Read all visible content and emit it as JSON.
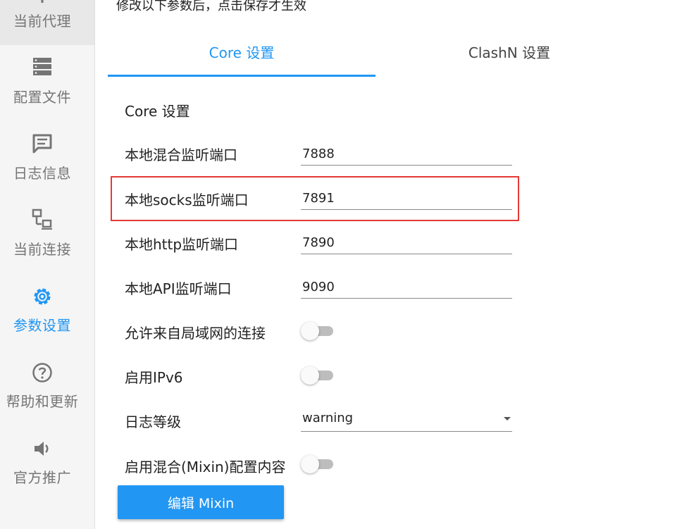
{
  "sidebar": {
    "items": [
      {
        "label": "当前代理",
        "icon": "proxy-icon"
      },
      {
        "label": "配置文件",
        "icon": "server-icon"
      },
      {
        "label": "日志信息",
        "icon": "message-icon"
      },
      {
        "label": "当前连接",
        "icon": "network-icon"
      },
      {
        "label": "参数设置",
        "icon": "gear-icon",
        "active": true
      },
      {
        "label": "帮助和更新",
        "icon": "help-icon"
      },
      {
        "label": "官方推广",
        "icon": "speaker-icon"
      }
    ]
  },
  "notice": "修改以下参数后，点击保存才生效",
  "tabs": [
    {
      "label": "Core 设置",
      "active": true
    },
    {
      "label": "ClashN 设置",
      "active": false
    }
  ],
  "section_title": "Core 设置",
  "fields": {
    "mixed_port": {
      "label": "本地混合监听端口",
      "value": "7888"
    },
    "socks_port": {
      "label": "本地socks监听端口",
      "value": "7891"
    },
    "http_port": {
      "label": "本地http监听端口",
      "value": "7890"
    },
    "api_port": {
      "label": "本地API监听端口",
      "value": "9090"
    }
  },
  "toggles": {
    "allow_lan": {
      "label": "允许来自局域网的连接",
      "on": false
    },
    "ipv6": {
      "label": "启用IPv6",
      "on": false
    },
    "mixin": {
      "label": "启用混合(Mixin)配置内容",
      "on": false
    }
  },
  "log_level": {
    "label": "日志等级",
    "value": "warning"
  },
  "mixin_button": "编辑 Mixin",
  "colors": {
    "accent": "#2196f3",
    "highlight": "#e53935"
  }
}
